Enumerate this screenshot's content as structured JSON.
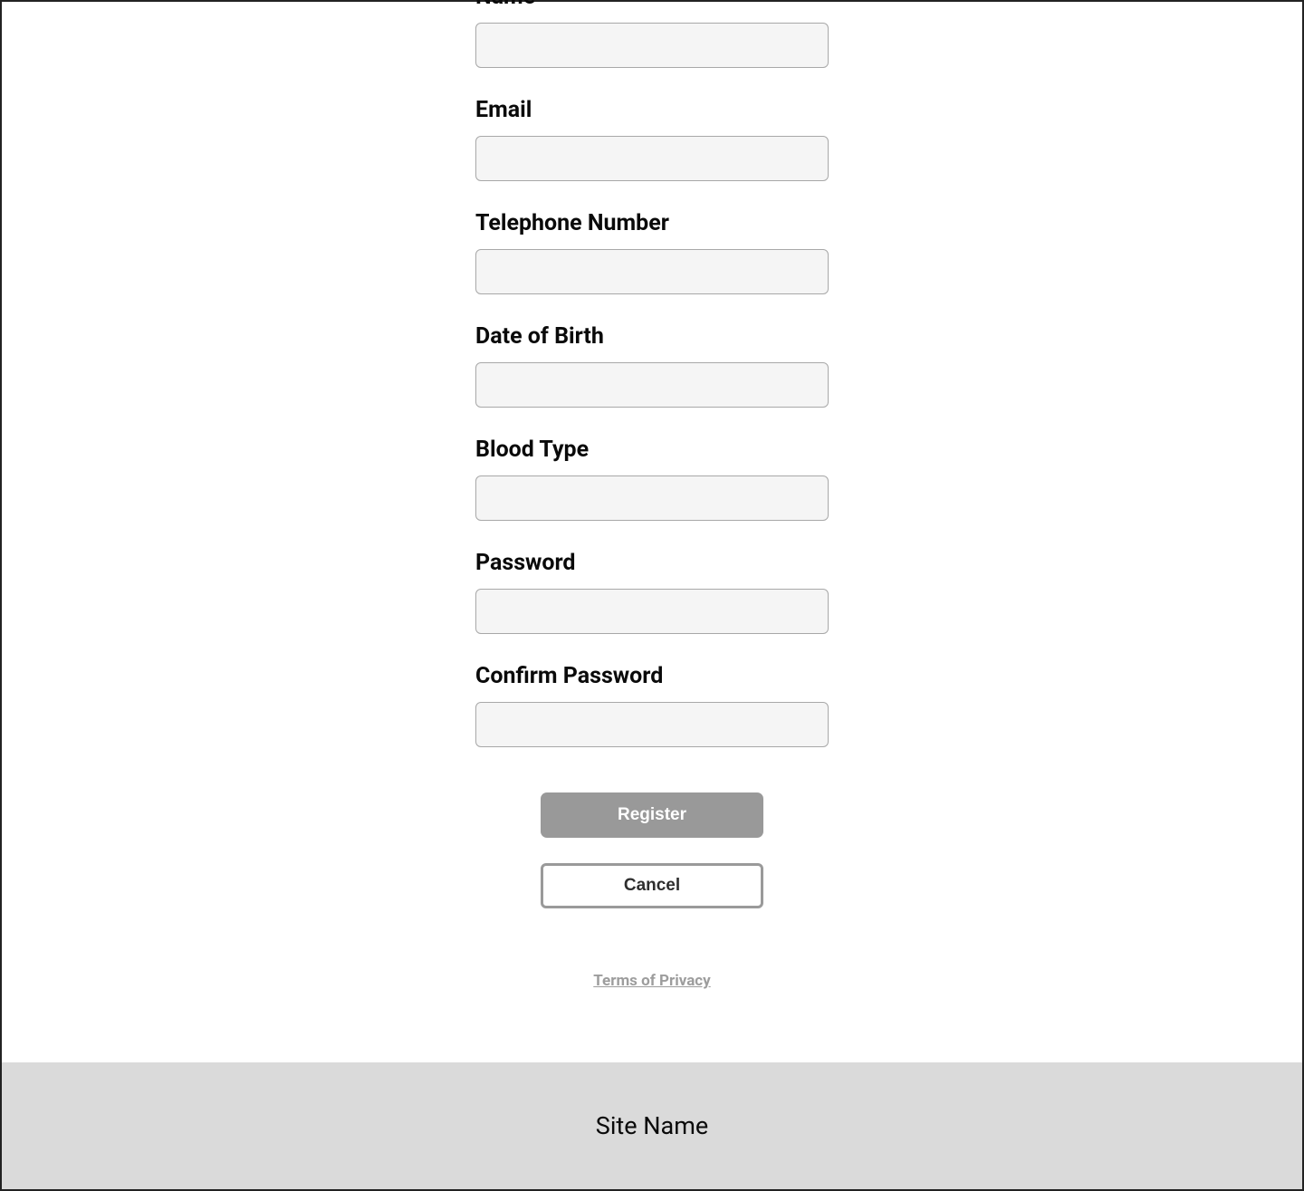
{
  "form": {
    "fields": {
      "name": {
        "label": "Name",
        "value": ""
      },
      "email": {
        "label": "Email",
        "value": ""
      },
      "telephone": {
        "label": "Telephone Number",
        "value": ""
      },
      "dob": {
        "label": "Date of Birth",
        "value": ""
      },
      "blood_type": {
        "label": "Blood Type",
        "value": ""
      },
      "password": {
        "label": "Password",
        "value": ""
      },
      "confirm_password": {
        "label": "Confirm Password",
        "value": ""
      }
    },
    "buttons": {
      "register": "Register",
      "cancel": "Cancel"
    },
    "terms_link": "Terms of Privacy"
  },
  "footer": {
    "site_name": "Site Name"
  }
}
